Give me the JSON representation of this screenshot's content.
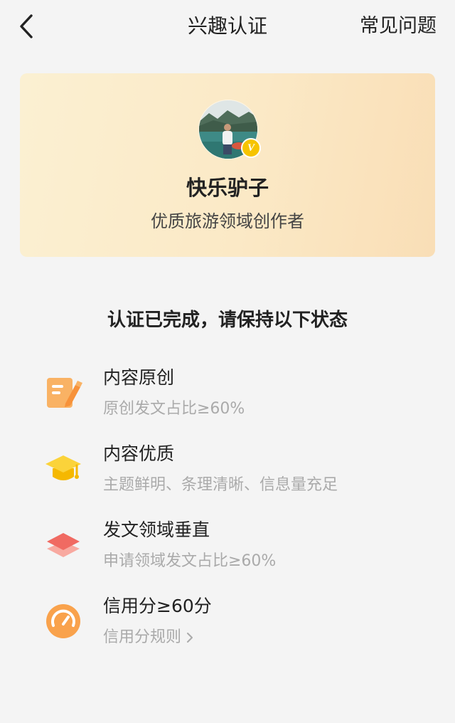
{
  "header": {
    "title": "兴趣认证",
    "faq_label": "常见问题"
  },
  "profile": {
    "name": "快乐驴子",
    "role": "优质旅游领域创作者",
    "badge": "V"
  },
  "section_title": "认证已完成，请保持以下状态",
  "requirements": [
    {
      "title": "内容原创",
      "desc": "原创发文占比≥60%",
      "icon": "document-edit-icon",
      "color": "#f7a650"
    },
    {
      "title": "内容优质",
      "desc": "主题鲜明、条理清晰、信息量充足",
      "icon": "graduation-cap-icon",
      "color": "#f8c92a"
    },
    {
      "title": "发文领域垂直",
      "desc": "申请领域发文占比≥60%",
      "icon": "layers-icon",
      "color": "#f26a6a"
    },
    {
      "title": "信用分≥60分",
      "desc": "信用分规则",
      "icon": "gauge-icon",
      "color": "#f7a04a"
    }
  ],
  "colors": {
    "background": "#f4f4f4",
    "card_gradient_start": "#fbf0d2",
    "card_gradient_end": "#f9deb6",
    "badge": "#f6c400",
    "muted_text": "#aaaaaa"
  }
}
